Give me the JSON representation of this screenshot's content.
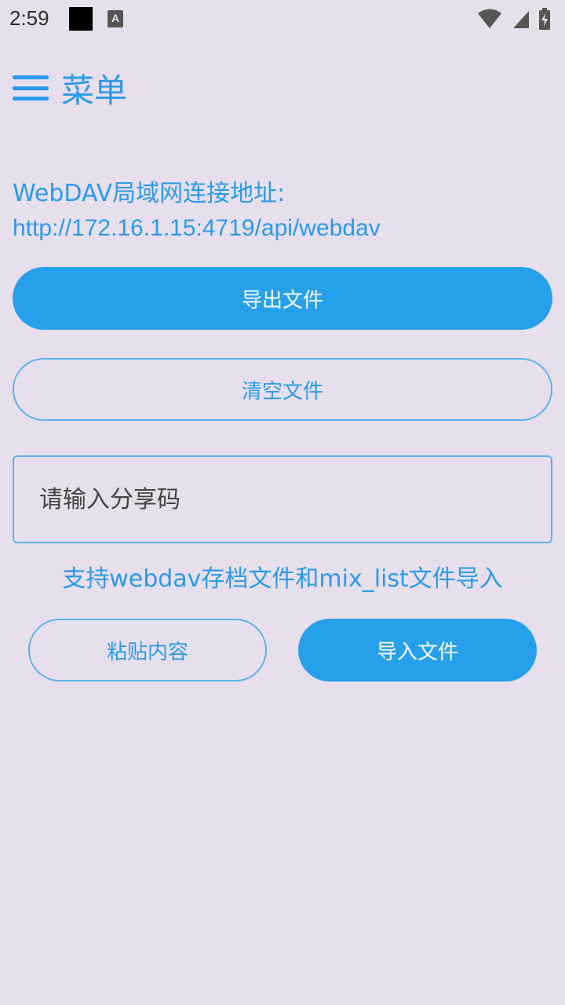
{
  "status_bar": {
    "time": "2:59",
    "notification_letter": "A"
  },
  "header": {
    "menu_title": "菜单"
  },
  "webdav": {
    "label": "WebDAV局域网连接地址:",
    "url": "http://172.16.1.15:4719/api/webdav"
  },
  "buttons": {
    "export_label": "导出文件",
    "clear_label": "清空文件",
    "paste_label": "粘贴内容",
    "import_label": "导入文件"
  },
  "share_code": {
    "placeholder": "请输入分享码",
    "value": ""
  },
  "support_text": "支持webdav存档文件和mix_list文件导入",
  "colors": {
    "background": "#e7dfec",
    "accent": "#27a0ec",
    "accent_text": "#2b9be8",
    "outline": "#5cb3ec"
  },
  "icons": {
    "menu": "hamburger-menu-icon",
    "wifi": "wifi-icon",
    "signal": "cell-signal-icon",
    "battery": "battery-charging-icon",
    "notification_1": "black-square-notification-icon",
    "notification_2": "font-a-notification-icon"
  }
}
